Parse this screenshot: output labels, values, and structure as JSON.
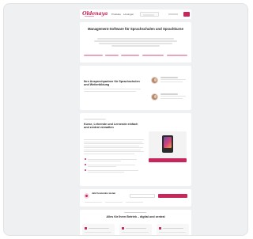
{
  "header": {
    "logo": "Oldenaya",
    "nav": [
      "Produkte",
      "Lösungen"
    ]
  },
  "hero": {
    "title": "Management-Software für Sprachschulen und Sprachkurse"
  },
  "experts": {
    "title": "Ihre Ansprechpartner für Sprachschulen und Weiterbildung"
  },
  "product": {
    "title": "Kurse, Lehrende und Lernende einfach und zentral verwalten"
  },
  "cta": {
    "title": "Jetzt kostenlos testen"
  },
  "features": {
    "title": "Alles für Ihren Betrieb – digital und zentral"
  },
  "colors": {
    "accent": "#c7285b",
    "background": "#eef0f1"
  }
}
